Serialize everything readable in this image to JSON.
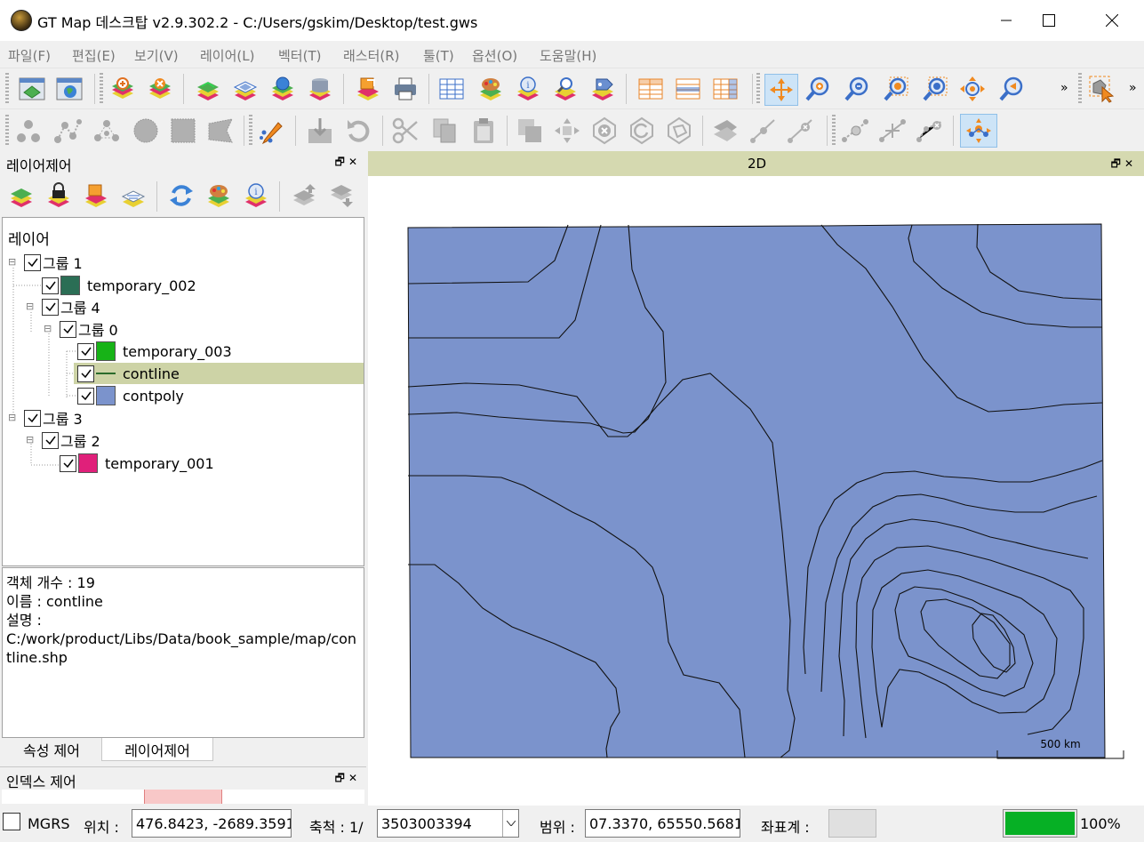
{
  "window": {
    "title": "GT Map 데스크탑 v2.9.302.2 - C:/Users/gskim/Desktop/test.gws",
    "minimize_label": "─",
    "maximize_label": "☐",
    "close_label": "✕"
  },
  "menu": [
    "파일(F)",
    "편집(E)",
    "보기(V)",
    "레이어(L)",
    "벡터(T)",
    "래스터(R)",
    "툴(T)",
    "옵션(O)",
    "도움말(H)"
  ],
  "toolbar": {
    "overflow": "»"
  },
  "layer_panel": {
    "title": "레이어제어",
    "tree_root": "레이어",
    "nodes": [
      {
        "label": "그룹 1",
        "checked": true
      },
      {
        "label": "temporary_002",
        "checked": true,
        "color": "#2b6e55"
      },
      {
        "label": "그룹 4",
        "checked": true
      },
      {
        "label": "그룹 0",
        "checked": true
      },
      {
        "label": "temporary_003",
        "checked": true,
        "color": "#17b317"
      },
      {
        "label": "contline",
        "checked": true,
        "color": "#2b6b2b",
        "selected": true
      },
      {
        "label": "contpoly",
        "checked": true,
        "color": "#7b93cc"
      },
      {
        "label": "그룹 3",
        "checked": true
      },
      {
        "label": "그룹 2",
        "checked": true
      },
      {
        "label": "temporary_001",
        "checked": true,
        "color": "#e0207a"
      }
    ]
  },
  "info": {
    "count": "객체 개수 : 19",
    "name": "이름 : contline",
    "desc_label": "설명 :",
    "path": "C:/work/product/Libs/Data/book_sample/map/contline.shp"
  },
  "tabs": [
    "속성 제어",
    "레이어제어"
  ],
  "index_panel": {
    "title": "인덱스 제어"
  },
  "map": {
    "title": "2D",
    "fill_color": "#7b93cc",
    "scale_label": "500 km"
  },
  "status": {
    "mgrs_label": "MGRS",
    "position_label": "위치 :",
    "position_value": "476.8423, -2689.3591",
    "scale_label": "축척 : 1/",
    "scale_value": "3503003394",
    "extent_label": "범위 :",
    "extent_value": "07.3370, 65550.5681",
    "crs_label": "좌표계 :",
    "progress": 100,
    "progress_text": "100%"
  }
}
